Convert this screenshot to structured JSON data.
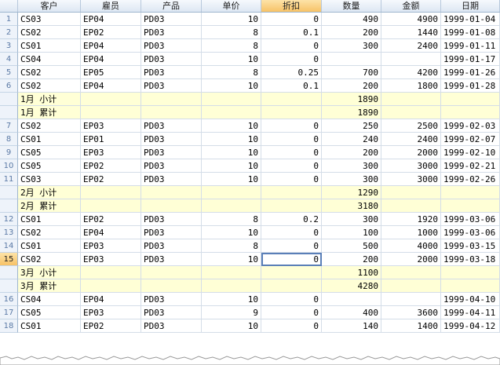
{
  "columns": [
    "客户",
    "雇员",
    "产品",
    "单价",
    "折扣",
    "数量",
    "金额",
    "日期"
  ],
  "rows": [
    {
      "rn": "1",
      "cells": [
        "CS03",
        "EP04",
        "PD03",
        "10",
        "0",
        "490",
        "4900",
        "1999-01-04"
      ]
    },
    {
      "rn": "2",
      "cells": [
        "CS02",
        "EP02",
        "PD03",
        "8",
        "0.1",
        "200",
        "1440",
        "1999-01-08"
      ]
    },
    {
      "rn": "3",
      "cells": [
        "CS01",
        "EP04",
        "PD03",
        "8",
        "0",
        "300",
        "2400",
        "1999-01-11"
      ]
    },
    {
      "rn": "4",
      "cells": [
        "CS04",
        "EP04",
        "PD03",
        "10",
        "0",
        "",
        "",
        "1999-01-17"
      ]
    },
    {
      "rn": "5",
      "cells": [
        "CS02",
        "EP05",
        "PD03",
        "8",
        "0.25",
        "700",
        "4200",
        "1999-01-26"
      ]
    },
    {
      "rn": "6",
      "cells": [
        "CS02",
        "EP04",
        "PD03",
        "10",
        "0.1",
        "200",
        "1800",
        "1999-01-28"
      ]
    },
    {
      "rn": "",
      "sum": true,
      "cells": [
        "1月 小计",
        "",
        "",
        "",
        "",
        "1890",
        "",
        ""
      ]
    },
    {
      "rn": "",
      "sum": true,
      "cells": [
        "1月 累计",
        "",
        "",
        "",
        "",
        "1890",
        "",
        ""
      ]
    },
    {
      "rn": "7",
      "cells": [
        "CS02",
        "EP03",
        "PD03",
        "10",
        "0",
        "250",
        "2500",
        "1999-02-03"
      ]
    },
    {
      "rn": "8",
      "cells": [
        "CS01",
        "EP01",
        "PD03",
        "10",
        "0",
        "240",
        "2400",
        "1999-02-07"
      ]
    },
    {
      "rn": "9",
      "cells": [
        "CS05",
        "EP03",
        "PD03",
        "10",
        "0",
        "200",
        "2000",
        "1999-02-10"
      ]
    },
    {
      "rn": "10",
      "cells": [
        "CS05",
        "EP02",
        "PD03",
        "10",
        "0",
        "300",
        "3000",
        "1999-02-21"
      ]
    },
    {
      "rn": "11",
      "cells": [
        "CS03",
        "EP02",
        "PD03",
        "10",
        "0",
        "300",
        "3000",
        "1999-02-26"
      ]
    },
    {
      "rn": "",
      "sum": true,
      "cells": [
        "2月 小计",
        "",
        "",
        "",
        "",
        "1290",
        "",
        ""
      ]
    },
    {
      "rn": "",
      "sum": true,
      "cells": [
        "2月 累计",
        "",
        "",
        "",
        "",
        "3180",
        "",
        ""
      ]
    },
    {
      "rn": "12",
      "cells": [
        "CS01",
        "EP02",
        "PD03",
        "8",
        "0.2",
        "300",
        "1920",
        "1999-03-06"
      ]
    },
    {
      "rn": "13",
      "cells": [
        "CS02",
        "EP04",
        "PD03",
        "10",
        "0",
        "100",
        "1000",
        "1999-03-06"
      ]
    },
    {
      "rn": "14",
      "cells": [
        "CS01",
        "EP03",
        "PD03",
        "8",
        "0",
        "500",
        "4000",
        "1999-03-15"
      ]
    },
    {
      "rn": "15",
      "sel": true,
      "cells": [
        "CS02",
        "EP03",
        "PD03",
        "10",
        "0",
        "200",
        "2000",
        "1999-03-18"
      ]
    },
    {
      "rn": "",
      "sum": true,
      "cells": [
        "3月 小计",
        "",
        "",
        "",
        "",
        "1100",
        "",
        ""
      ]
    },
    {
      "rn": "",
      "sum": true,
      "cells": [
        "3月 累计",
        "",
        "",
        "",
        "",
        "4280",
        "",
        ""
      ]
    },
    {
      "rn": "16",
      "cells": [
        "CS04",
        "EP04",
        "PD03",
        "10",
        "0",
        "",
        "",
        "1999-04-10"
      ]
    },
    {
      "rn": "17",
      "cells": [
        "CS05",
        "EP03",
        "PD03",
        "9",
        "0",
        "400",
        "3600",
        "1999-04-11"
      ]
    },
    {
      "rn": "18",
      "cells": [
        "CS01",
        "EP02",
        "PD03",
        "10",
        "0",
        "140",
        "1400",
        "1999-04-12"
      ]
    }
  ],
  "selected": {
    "row_number": "15",
    "column": "折扣"
  }
}
